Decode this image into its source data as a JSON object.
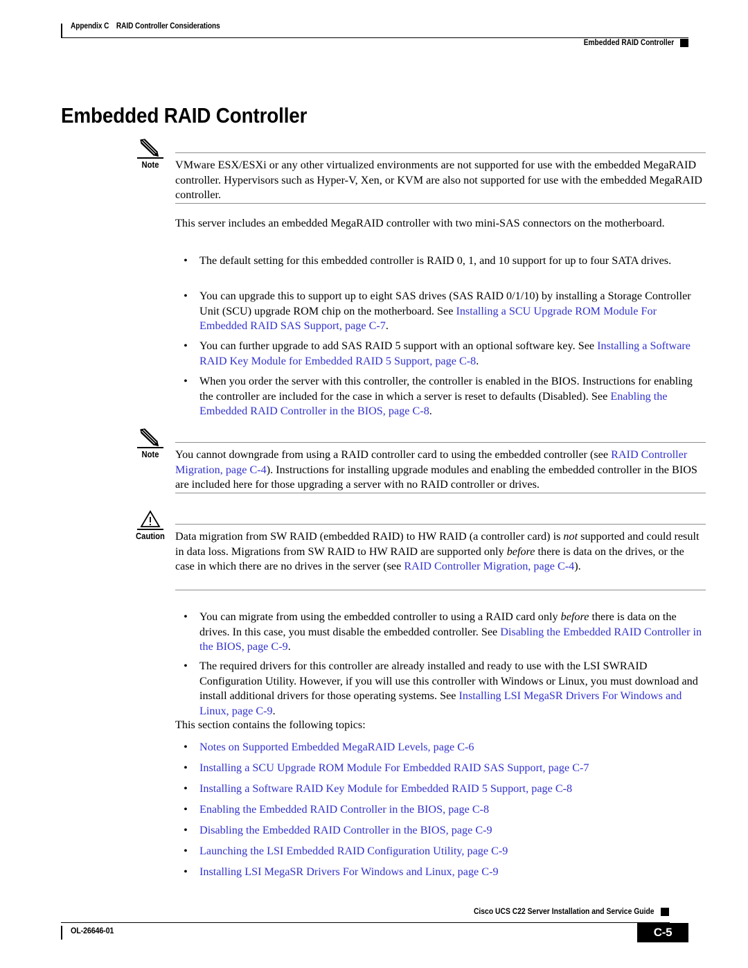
{
  "header": {
    "appendix": "Appendix C",
    "appendix_title": "RAID Controller Considerations",
    "section": "Embedded RAID Controller"
  },
  "title": "Embedded RAID Controller",
  "note1": {
    "label": "Note",
    "icon": "pencil-icon",
    "text": "VMware ESX/ESXi or any other virtualized environments are not supported for use with the embedded MegaRAID controller. Hypervisors such as Hyper-V, Xen, or KVM are also not supported for use with the embedded MegaRAID controller."
  },
  "intro_paragraph": "This server includes an embedded MegaRAID controller with two mini-SAS connectors on the motherboard.",
  "bullets_top": [
    {
      "text_before": "The default setting for this embedded controller is RAID 0, 1, and 10 support for up to four SATA drives.",
      "link": "",
      "text_after": ""
    },
    {
      "text_before": "You can upgrade this to support up to eight SAS drives (SAS RAID 0/1/10) by installing a Storage Controller Unit (SCU) upgrade ROM chip on the motherboard. See ",
      "link": "Installing a SCU Upgrade ROM Module For Embedded RAID SAS Support, page C-7",
      "text_after": "."
    },
    {
      "text_before": "You can further upgrade to add SAS RAID 5 support with an optional software key. See ",
      "link": "Installing a Software RAID Key Module for Embedded RAID 5 Support, page C-8",
      "text_after": "."
    },
    {
      "text_before": "When you order the server with this controller, the controller is enabled in the BIOS. Instructions for enabling the controller are included for the case in which a server is reset to defaults (Disabled). See ",
      "link": "Enabling the Embedded RAID Controller in the BIOS, page C-8",
      "text_after": "."
    }
  ],
  "note2": {
    "label": "Note",
    "icon": "pencil-icon",
    "text_before": "You cannot downgrade from using a RAID controller card to using the embedded controller (see ",
    "link": "RAID Controller Migration, page C-4",
    "text_after": "). Instructions for installing upgrade modules and enabling the embedded controller in the BIOS are included here for those upgrading a server with no RAID controller or drives."
  },
  "caution": {
    "label": "Caution",
    "icon": "warning-triangle-icon",
    "part1": "Data migration from SW RAID (embedded RAID) to HW RAID (a controller card) is ",
    "italic1": "not",
    "part2": " supported and could result in data loss. Migrations from SW RAID to HW RAID are supported only ",
    "italic2": "before",
    "part3": " there is data on the drives, or the case in which there are no drives in the server (see ",
    "link": "RAID Controller Migration, page C-4",
    "part4": ")."
  },
  "bullets_bottom": [
    {
      "part1": "You can migrate from using the embedded controller to using a RAID card only ",
      "italic": "before",
      "part2": " there is data on the drives. In this case, you must disable the embedded controller. See ",
      "link": "Disabling the Embedded RAID Controller in the BIOS, page C-9",
      "part3": "."
    },
    {
      "part1": "The required drivers for this controller are already installed and ready to use with the LSI SWRAID Configuration Utility. However, if you will use this controller with Windows or Linux, you must download and install additional drivers for those operating systems. See ",
      "italic": "",
      "part2": "",
      "link": "Installing LSI MegaSR Drivers For Windows and Linux, page C-9",
      "part3": "."
    }
  ],
  "topics_intro": "This section contains the following topics:",
  "topic_links": [
    "Notes on Supported Embedded MegaRAID Levels, page C-6",
    "Installing a SCU Upgrade ROM Module For Embedded RAID SAS Support, page C-7",
    "Installing a Software RAID Key Module for Embedded RAID 5 Support, page C-8",
    "Enabling the Embedded RAID Controller in the BIOS, page C-8",
    "Disabling the Embedded RAID Controller in the BIOS, page C-9",
    "Launching the LSI Embedded RAID Configuration Utility, page C-9",
    "Installing LSI MegaSR Drivers For Windows and Linux, page C-9"
  ],
  "footer": {
    "doc_id": "OL-26646-01",
    "guide_title": "Cisco UCS C22 Server Installation and Service Guide",
    "page_number": "C-5"
  },
  "colors": {
    "link": "#3232cd",
    "text": "#000000",
    "rule": "#8c8c8c"
  },
  "bullet_char": "•"
}
